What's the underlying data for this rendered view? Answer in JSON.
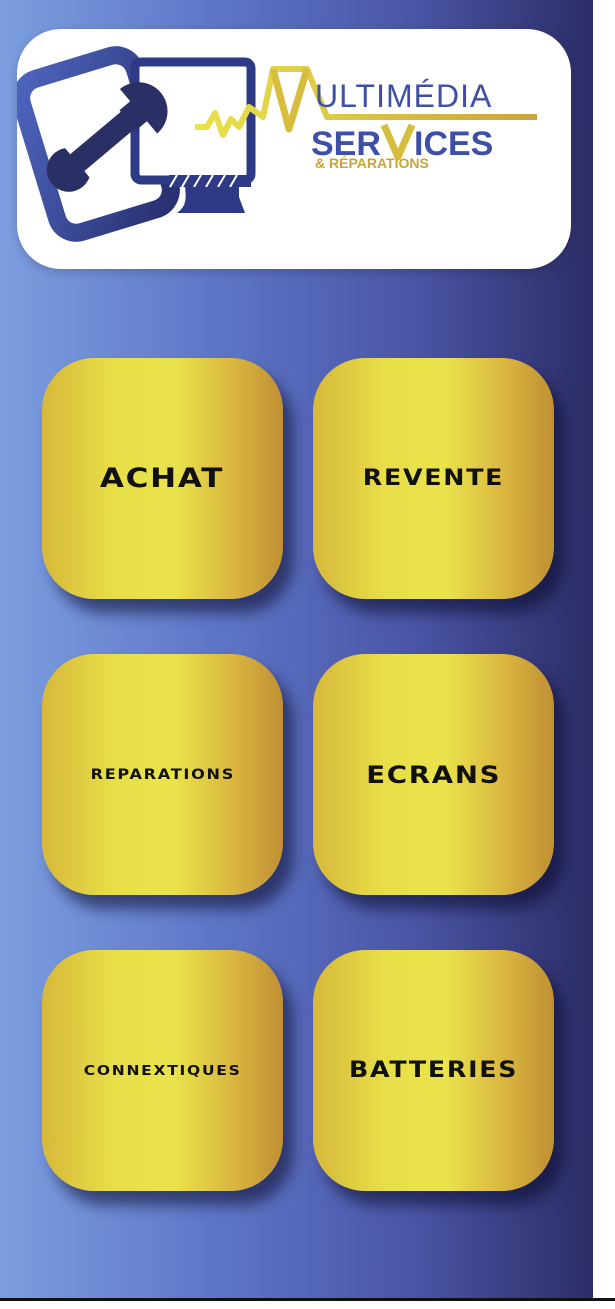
{
  "logo": {
    "line1": "ULTIMÉDIA",
    "line2_prefix": "SER",
    "line2_suffix": "ICES",
    "line3": "& RÉPARATIONS",
    "colors": {
      "navy": "#2f3a86",
      "blue": "#3d4fa6",
      "gold": "#c9a43a",
      "yellow": "#e6d640"
    }
  },
  "menu": {
    "items": [
      {
        "label": "ACHAT"
      },
      {
        "label": "REVENTE"
      },
      {
        "label": "REPARATIONS"
      },
      {
        "label": "ECRANS"
      },
      {
        "label": "CONNEXTIQUES"
      },
      {
        "label": "BATTERIES"
      }
    ]
  },
  "theme": {
    "background_gradient": [
      "#7c9ee0",
      "#2c2d66"
    ],
    "tile_gold": "#e8df48"
  }
}
